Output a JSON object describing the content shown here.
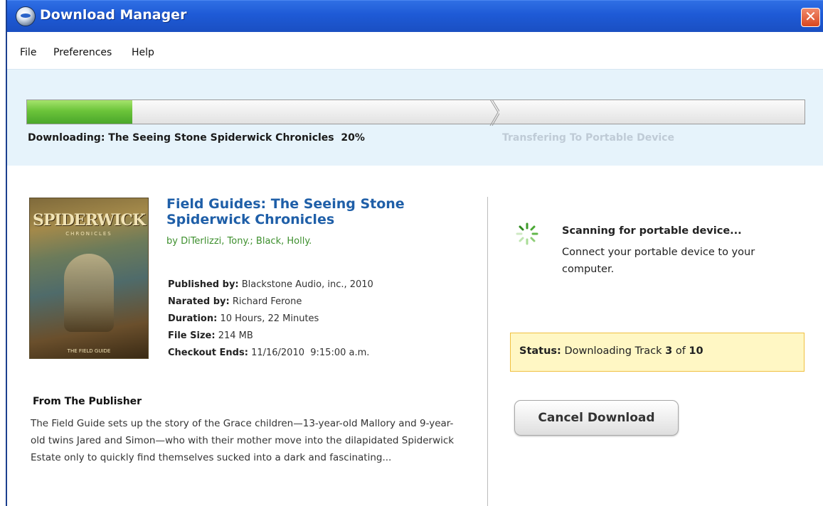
{
  "window": {
    "title": "Download Manager",
    "close_glyph": "✕"
  },
  "menu": [
    "File",
    "Preferences",
    "Help"
  ],
  "progress": {
    "download_fraction": 0.135,
    "label": "Downloading: The Seeing Stone Spiderwick Chronicles  20%",
    "transfer_label": "Transfering To Portable Device",
    "fill_color": "#5cb935"
  },
  "book": {
    "cover": {
      "title": "SPIDERWICK",
      "subtitle": "CHRONICLES",
      "footer": "THE FIELD GUIDE"
    },
    "title": "Field Guides: The Seeing Stone Spiderwick Chronicles",
    "authors": "by DiTerlizzi, Tony.; Black, Holly.",
    "details": [
      {
        "key": "Published by:",
        "value": "Blackstone Audio, inc., 2010"
      },
      {
        "key": "Narated by:",
        "value": "Richard Ferone"
      },
      {
        "key": "Duration:",
        "value": "10 Hours, 22 Minutes"
      },
      {
        "key": "File Size:",
        "value": "214 MB"
      },
      {
        "key": "Checkout Ends:",
        "value": "11/16/2010  9:15:00 a.m."
      }
    ],
    "publisher_heading": "From The Publisher",
    "publisher_text": "The Field Guide sets up the story of the Grace children—13-year-old Mallory and 9-year-old twins Jared and Simon—who with their mother move into the dilapidated Spiderwick Estate only to quickly find themselves sucked into a dark and fascinating..."
  },
  "device": {
    "spinner_icon": "loading-spinner-icon",
    "title": "Scanning for portable device...",
    "text": "Connect your portable device to your computer."
  },
  "status": {
    "label": "Status:",
    "prefix": "Downloading Track",
    "current": "3",
    "of": "of",
    "total": "10"
  },
  "cancel_label": "Cancel Download"
}
